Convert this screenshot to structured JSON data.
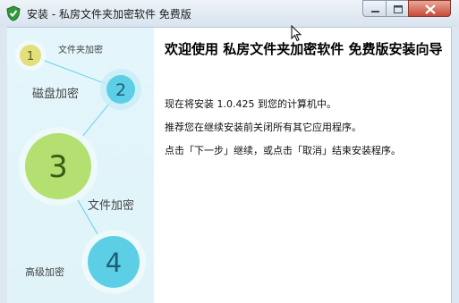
{
  "window": {
    "title": "安装 - 私房文件夹加密软件 免费版",
    "icon": "shield-check-icon",
    "controls": [
      "minimize-icon",
      "maximize-icon",
      "close-icon"
    ]
  },
  "sidebar": {
    "steps": [
      {
        "number": "1",
        "label": "文件夹加密",
        "color": "#e2e07a"
      },
      {
        "number": "2",
        "label": "磁盘加密",
        "color": "#5ccfe6"
      },
      {
        "number": "3",
        "label": "",
        "color": "#b3e070"
      },
      {
        "number": "4",
        "label": "文件加密",
        "color": "#5ccfe6"
      },
      {
        "number": "",
        "label": "高级加密",
        "color": ""
      }
    ]
  },
  "main": {
    "heading": "欢迎使用 私房文件夹加密软件 免费版安装向导",
    "paragraphs": [
      "现在将安装 1.0.425 到您的计算机中。",
      "推荐您在继续安装前关闭所有其它应用程序。",
      "点击「下一步」继续，或点击「取消」结束安装程序。"
    ]
  },
  "colors": {
    "sidebar_bg": "#e0f4fa",
    "connector": "#64d2e8",
    "close_button": "#c74b38"
  }
}
